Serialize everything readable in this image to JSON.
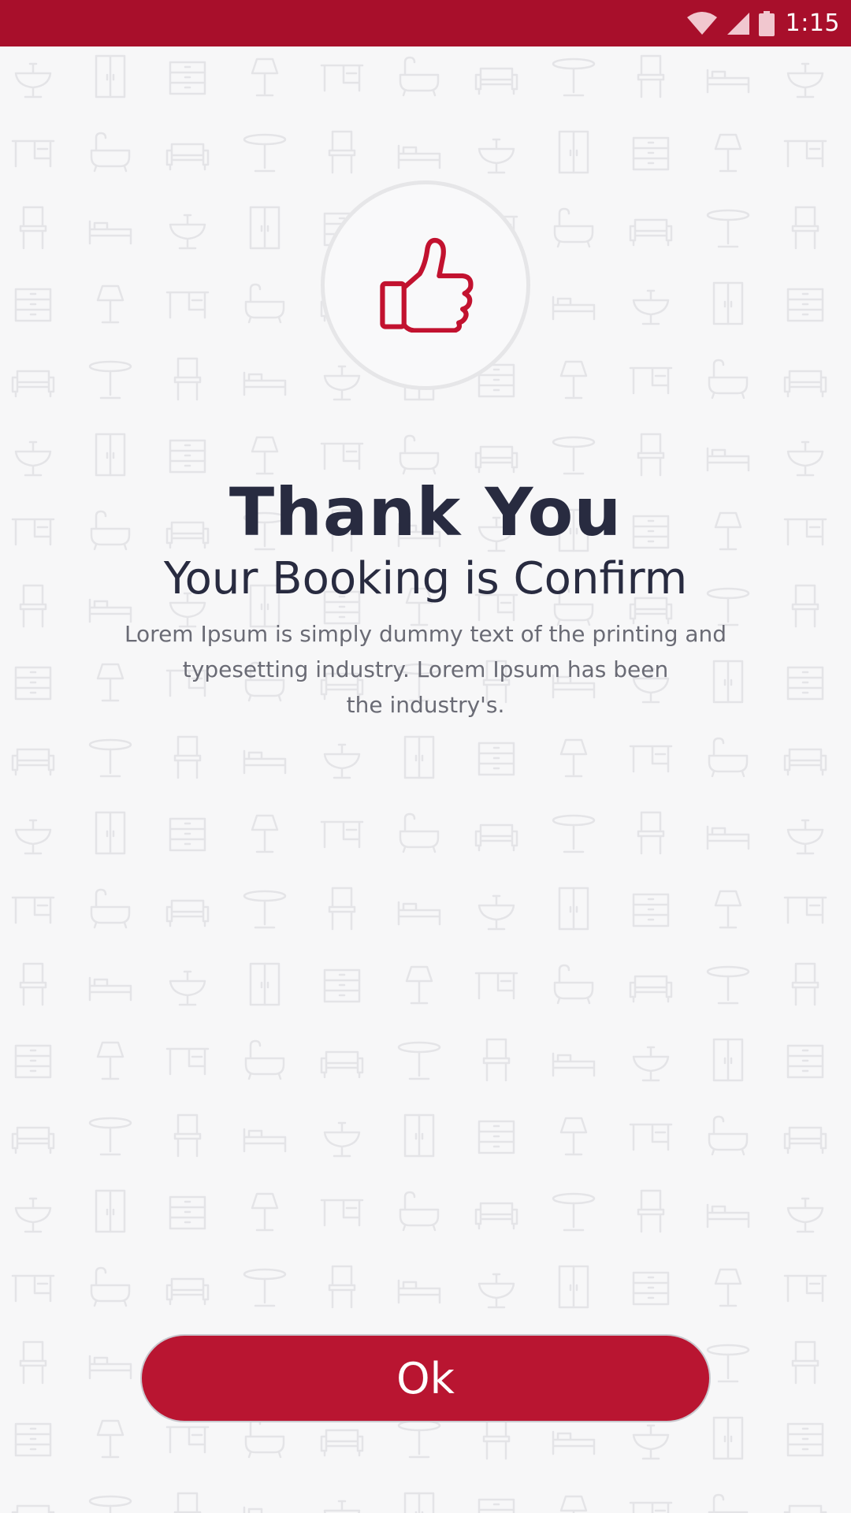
{
  "status_bar": {
    "time": "1:15",
    "icons": [
      "wifi-icon",
      "cell-signal-icon",
      "battery-icon"
    ],
    "background": "#a80f2b"
  },
  "background_pattern": {
    "icons": [
      "sink-icon",
      "wardrobe-icon",
      "dresser-icon",
      "lamp-icon",
      "desk-icon",
      "bathtub-icon",
      "sofa-icon",
      "table-icon",
      "chair-icon",
      "bed-icon"
    ]
  },
  "confirmation": {
    "icon": "thumbs-up-icon",
    "accent": "#b91531",
    "title": "Thank You",
    "subtitle": "Your Booking is Confirm",
    "description_lines": [
      "Lorem Ipsum is simply dummy text of the printing and",
      "typesetting industry. Lorem Ipsum has been",
      "the industry's."
    ]
  },
  "actions": {
    "ok_label": "Ok"
  }
}
